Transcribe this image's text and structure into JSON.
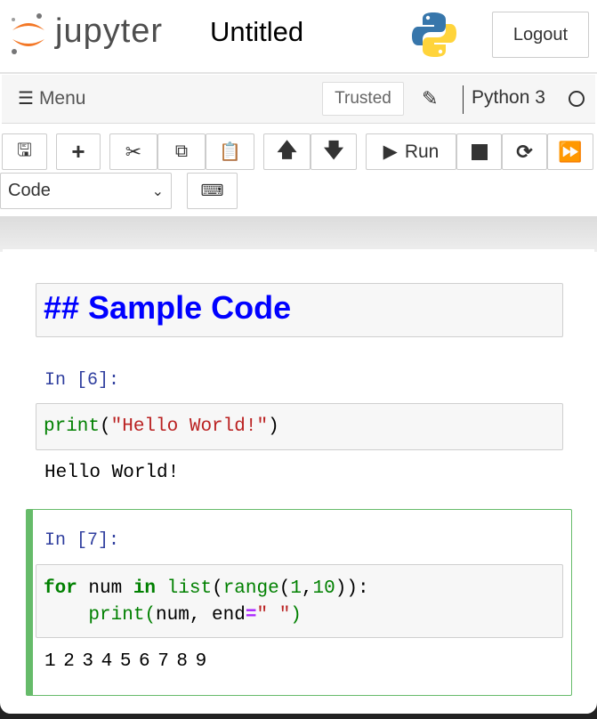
{
  "header": {
    "logo_text": "jupyter",
    "title": "Untitled",
    "logout_label": "Logout"
  },
  "menubar": {
    "menu_label": "Menu",
    "trusted_label": "Trusted",
    "kernel_name": "Python 3"
  },
  "toolbar": {
    "run_label": "Run",
    "cell_type": "Code"
  },
  "cells": [
    {
      "type": "markdown",
      "source": "## Sample Code"
    },
    {
      "type": "code",
      "prompt": "In [6]:",
      "code": [
        [
          {
            "t": "print",
            "c": "bi"
          },
          {
            "t": "(",
            "c": ""
          },
          {
            "t": "\"Hello World!\"",
            "c": "st"
          },
          {
            "t": ")",
            "c": ""
          }
        ]
      ],
      "output": "Hello World!"
    },
    {
      "type": "code",
      "prompt": "In [7]:",
      "selected": true,
      "code": [
        [
          {
            "t": "for",
            "c": "kw"
          },
          {
            "t": " num ",
            "c": ""
          },
          {
            "t": "in",
            "c": "kw"
          },
          {
            "t": " ",
            "c": ""
          },
          {
            "t": "list",
            "c": "bi"
          },
          {
            "t": "(",
            "c": ""
          },
          {
            "t": "range",
            "c": "bi"
          },
          {
            "t": "(",
            "c": ""
          },
          {
            "t": "1",
            "c": "bi"
          },
          {
            "t": ",",
            "c": ""
          },
          {
            "t": "10",
            "c": "bi"
          },
          {
            "t": ")):",
            "c": ""
          }
        ],
        [
          {
            "t": "    ",
            "c": ""
          },
          {
            "t": "print",
            "c": "bi"
          },
          {
            "t": "(",
            "c": "bi"
          },
          {
            "t": "num, end",
            "c": ""
          },
          {
            "t": "=",
            "c": "op"
          },
          {
            "t": "\" \"",
            "c": "st"
          },
          {
            "t": ")",
            "c": "bi"
          }
        ]
      ],
      "output": "1 2 3 4 5 6 7 8 9"
    }
  ],
  "colors": {
    "prompt": "#303f9f",
    "selected_border": "#66bb6a",
    "heading": "#0000ff",
    "jupyter_orange": "#f37726"
  }
}
